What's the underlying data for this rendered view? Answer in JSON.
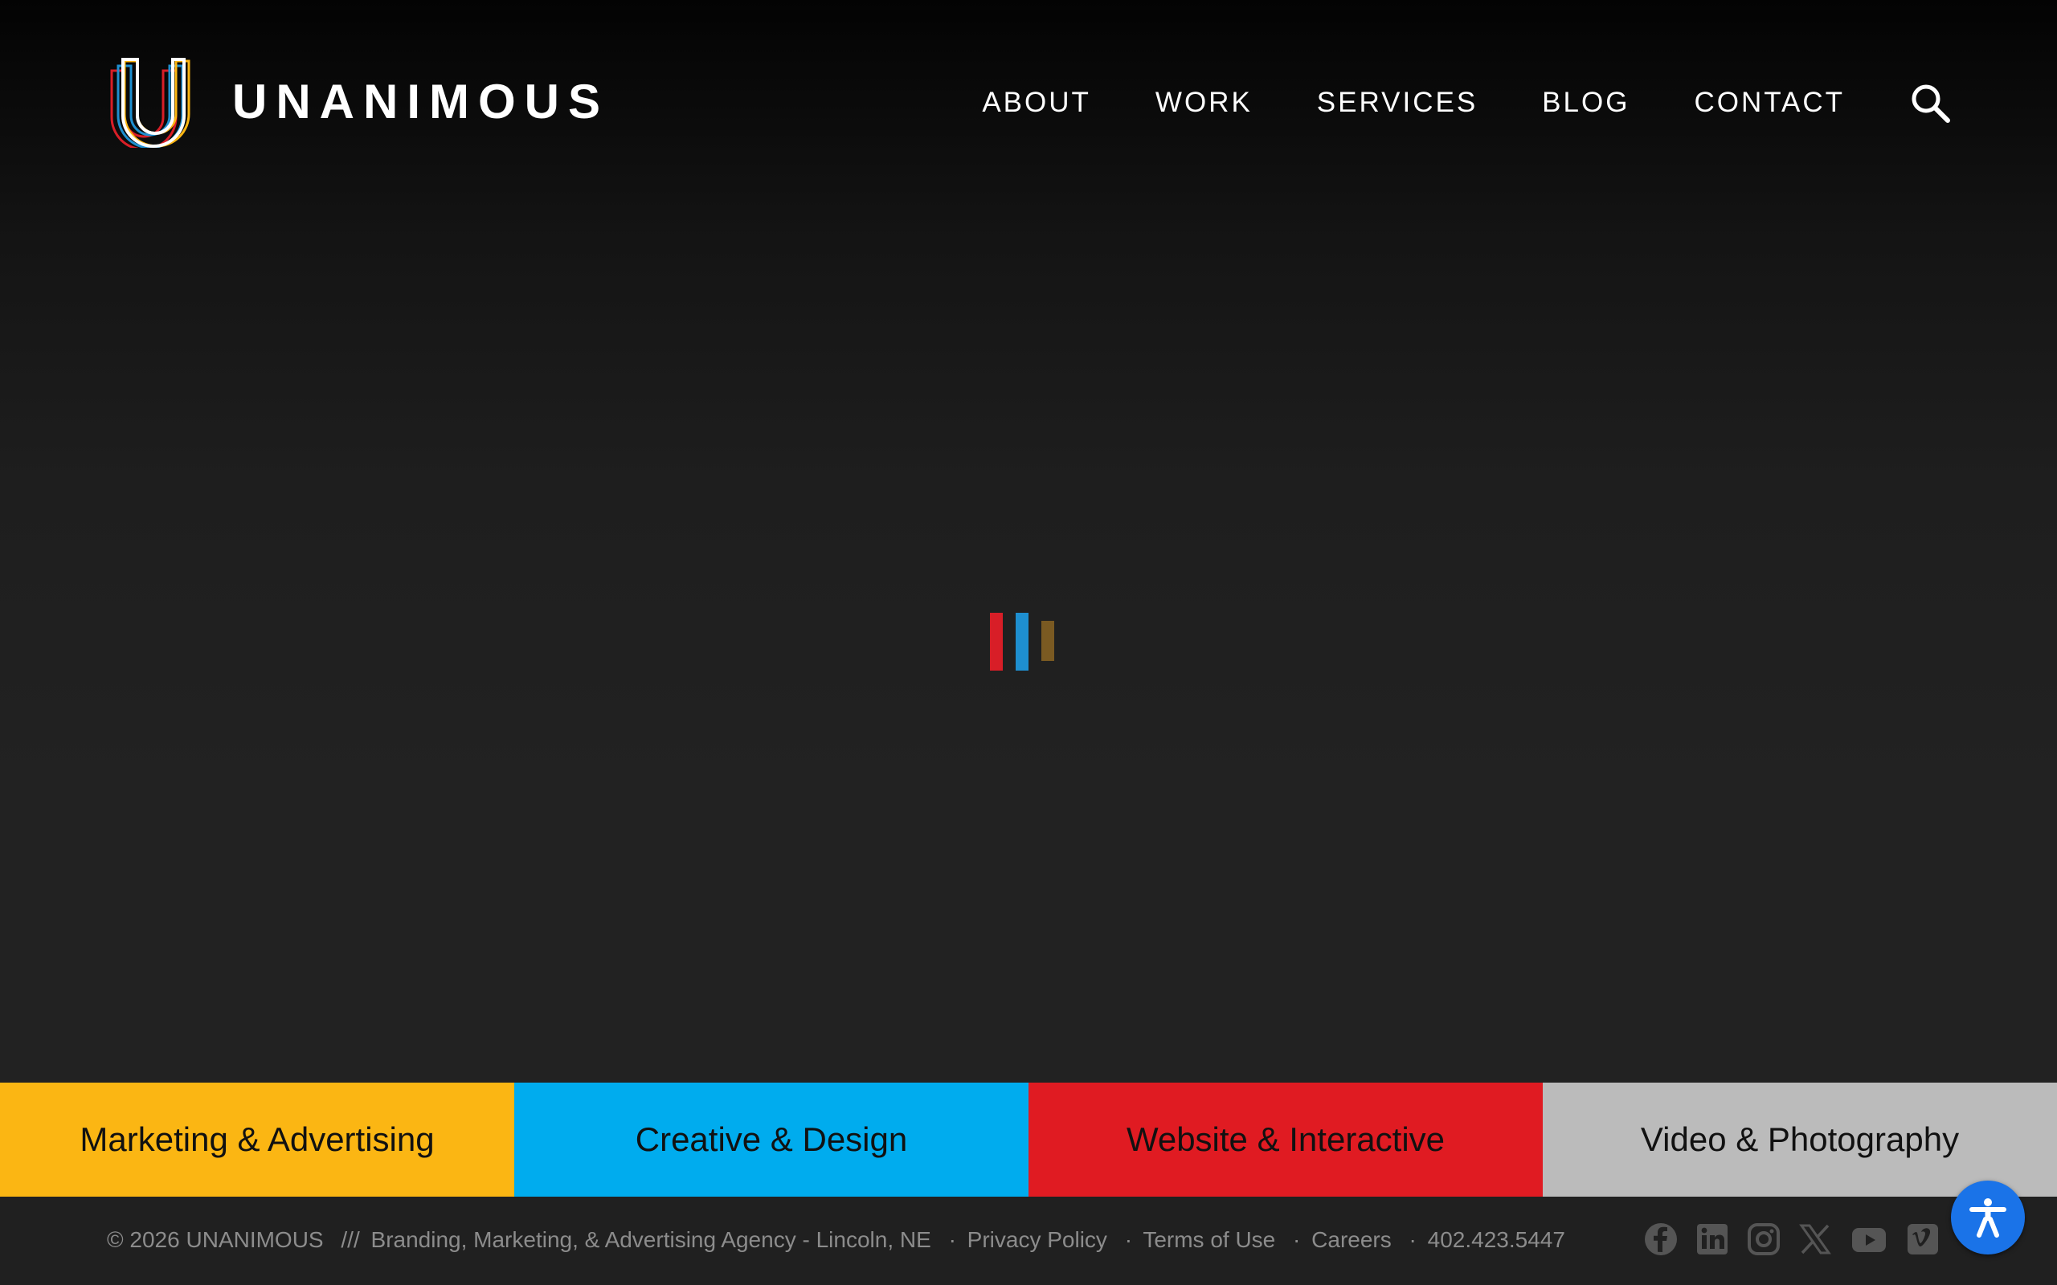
{
  "header": {
    "brand": "UNANIMOUS",
    "nav": [
      {
        "label": "ABOUT"
      },
      {
        "label": "WORK"
      },
      {
        "label": "SERVICES"
      },
      {
        "label": "BLOG"
      },
      {
        "label": "CONTACT"
      }
    ],
    "search_icon": "search-icon"
  },
  "loader": {
    "colors": [
      "#d81e27",
      "#1e8fd0",
      "#7a5a22"
    ]
  },
  "services": [
    {
      "label": "Marketing & Advertising",
      "color": "#fbb613"
    },
    {
      "label": "Creative & Design",
      "color": "#00acee"
    },
    {
      "label": "Website & Interactive",
      "color": "#e01b22"
    },
    {
      "label": "Video & Photography",
      "color": "#bbbbbb"
    }
  ],
  "footer": {
    "copyright": "© 2026 UNANIMOUS",
    "divider": "///",
    "tagline": "Branding, Marketing, & Advertising Agency - Lincoln, NE",
    "dot": "·",
    "links": [
      "Privacy Policy",
      "Terms of Use",
      "Careers",
      "402.423.5447"
    ],
    "social": [
      "facebook-icon",
      "linkedin-icon",
      "instagram-icon",
      "x-icon",
      "youtube-icon",
      "vimeo-icon"
    ]
  },
  "accessibility": {
    "icon": "accessibility-icon"
  }
}
